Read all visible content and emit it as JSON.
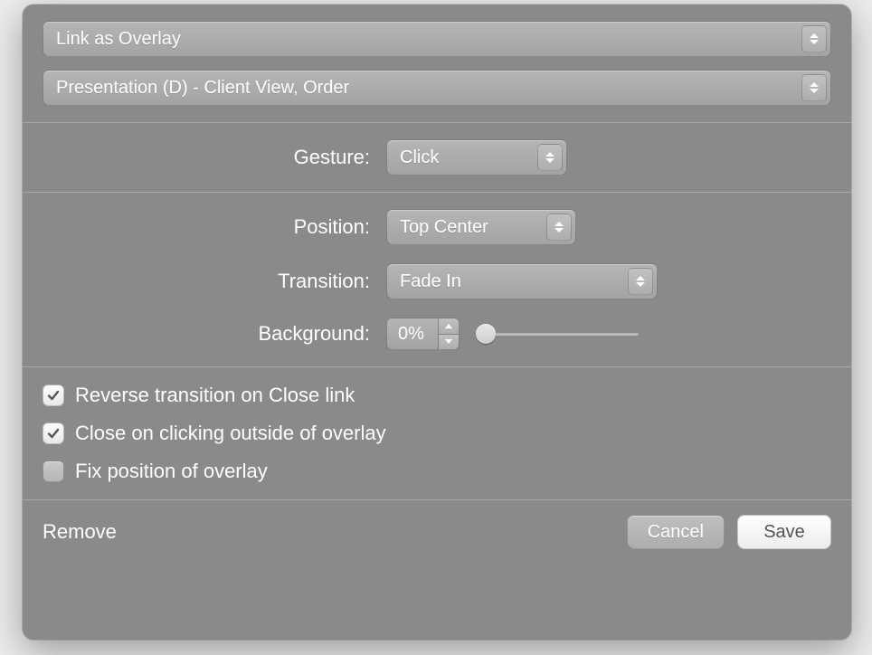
{
  "top_selects": {
    "link_mode": "Link as Overlay",
    "target": "Presentation (D) - Client View, Order"
  },
  "gesture": {
    "label": "Gesture:",
    "value": "Click"
  },
  "position": {
    "label": "Position:",
    "value": "Top Center"
  },
  "transition": {
    "label": "Transition:",
    "value": "Fade In"
  },
  "background": {
    "label": "Background:",
    "value": "0%",
    "slider_percent": 0
  },
  "checks": {
    "reverse": {
      "label": "Reverse transition on Close link",
      "checked": true
    },
    "close_outside": {
      "label": "Close on clicking outside of overlay",
      "checked": true
    },
    "fix_pos": {
      "label": "Fix position of overlay",
      "checked": false
    }
  },
  "footer": {
    "remove": "Remove",
    "cancel": "Cancel",
    "save": "Save"
  }
}
